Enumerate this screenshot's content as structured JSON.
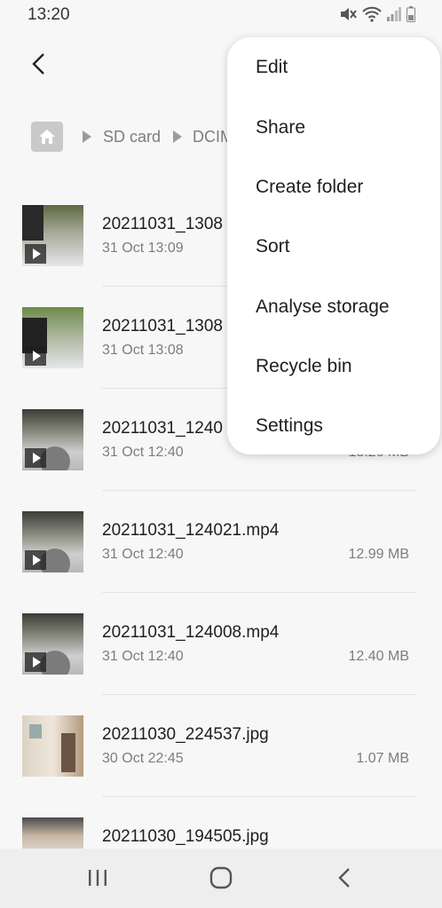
{
  "status_bar": {
    "time": "13:20"
  },
  "breadcrumb": {
    "items": [
      "SD card",
      "DCIM"
    ]
  },
  "files": [
    {
      "name": "20211031_1308",
      "date": "31 Oct 13:09",
      "size": "",
      "type": "video"
    },
    {
      "name": "20211031_1308",
      "date": "31 Oct 13:08",
      "size": "",
      "type": "video"
    },
    {
      "name": "20211031_1240",
      "date": "31 Oct 12:40",
      "size": "13.26 MB",
      "type": "video"
    },
    {
      "name": "20211031_124021.mp4",
      "date": "31 Oct 12:40",
      "size": "12.99 MB",
      "type": "video"
    },
    {
      "name": "20211031_124008.mp4",
      "date": "31 Oct 12:40",
      "size": "12.40 MB",
      "type": "video"
    },
    {
      "name": "20211030_224537.jpg",
      "date": "30 Oct 22:45",
      "size": "1.07 MB",
      "type": "image"
    },
    {
      "name": "20211030_194505.jpg",
      "date": "",
      "size": "",
      "type": "image"
    }
  ],
  "menu": {
    "items": [
      "Edit",
      "Share",
      "Create folder",
      "Sort",
      "Analyse storage",
      "Recycle bin",
      "Settings"
    ]
  }
}
